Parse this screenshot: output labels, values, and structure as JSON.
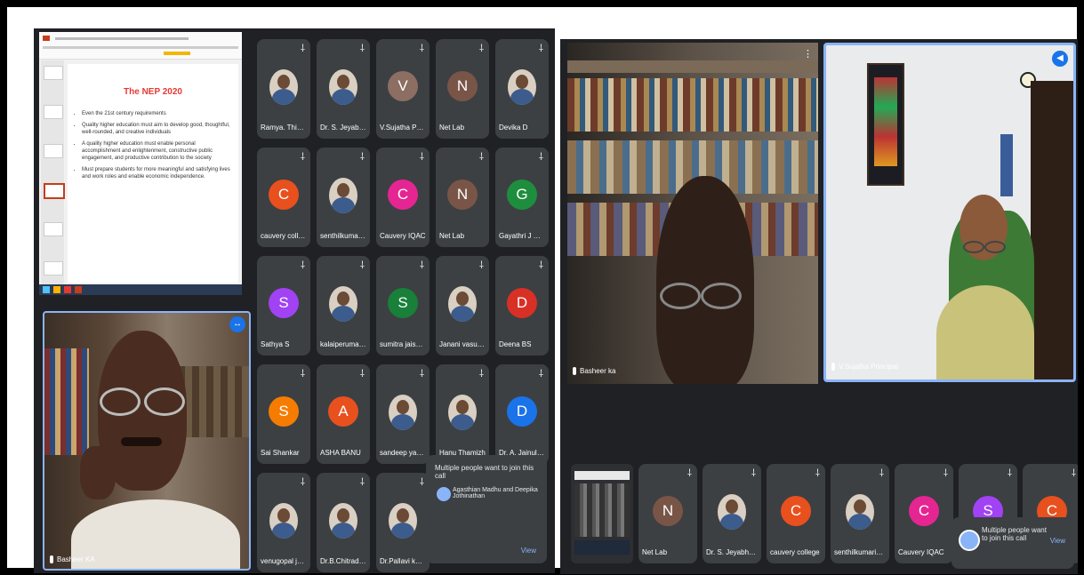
{
  "left_panel": {
    "slide": {
      "title": "The NEP 2020",
      "bullets": [
        "Even the 21st century requirements",
        "Quality higher education must aim to develop good, thoughtful, well-rounded, and creative individuals",
        "A quality higher education must enable personal accomplishment and enlightenment, constructive public engagement, and productive contribution to the society",
        "Must prepare students for more meaningful and satisfying lives and work roles and enable economic independence."
      ]
    },
    "speaker_name": "Basheer KA",
    "tiles": [
      {
        "name": "Ramya. Thiyagar...",
        "letter": "",
        "color": ""
      },
      {
        "name": "Dr. S. Jeyabharat...",
        "letter": "",
        "color": ""
      },
      {
        "name": "V.Sujatha Princip...",
        "letter": "V",
        "color": "#8d6e63"
      },
      {
        "name": "Net Lab",
        "letter": "N",
        "color": "#795548"
      },
      {
        "name": "Devika D",
        "letter": "",
        "color": ""
      },
      {
        "name": "cauvery college",
        "letter": "C",
        "color": "#e8501e"
      },
      {
        "name": "senthilkumaris E...",
        "letter": "",
        "color": ""
      },
      {
        "name": "Cauvery IQAC",
        "letter": "C",
        "color": "#e52592"
      },
      {
        "name": "Net Lab",
        "letter": "N",
        "color": "#795548"
      },
      {
        "name": "Gayathri J PSGR...",
        "letter": "G",
        "color": "#1e8e3e"
      },
      {
        "name": "Sathya S",
        "letter": "S",
        "color": "#a142f4"
      },
      {
        "name": "kalaiperumal se...",
        "letter": "",
        "color": ""
      },
      {
        "name": "sumitra jaiswal",
        "letter": "S",
        "color": "#188038"
      },
      {
        "name": "Janani vasudevan",
        "letter": "",
        "color": ""
      },
      {
        "name": "Deena BS",
        "letter": "D",
        "color": "#d93025"
      },
      {
        "name": "Sai Shankar",
        "letter": "S",
        "color": "#f57c00"
      },
      {
        "name": "ASHA BANU",
        "letter": "A",
        "color": "#e8501e"
      },
      {
        "name": "sandeep yadav",
        "letter": "",
        "color": ""
      },
      {
        "name": "Hanu Thamizh",
        "letter": "",
        "color": ""
      },
      {
        "name": "Dr. A. Jainulabd...",
        "letter": "D",
        "color": "#1a73e8"
      },
      {
        "name": "venugopal janar...",
        "letter": "",
        "color": ""
      },
      {
        "name": "Dr.B.Chitradevi",
        "letter": "",
        "color": ""
      },
      {
        "name": "Dr.Pallavi kunda...",
        "letter": "",
        "color": ""
      }
    ],
    "notice": {
      "title": "Multiple people want to join this call",
      "people": "Agasthian Madhu and Deepika Jothinathan",
      "view_label": "View"
    }
  },
  "right_panel": {
    "main_left_name": "Basheer ka",
    "main_right_name": "V.Sujatha Principal",
    "tiles": [
      {
        "name": "Net Lab",
        "letter": "N",
        "color": "#795548"
      },
      {
        "name": "Dr. S. Jeyabharathi...",
        "letter": "",
        "color": ""
      },
      {
        "name": "cauvery college",
        "letter": "C",
        "color": "#e8501e"
      },
      {
        "name": "senthilkumaris En...",
        "letter": "",
        "color": ""
      },
      {
        "name": "Cauvery IQAC",
        "letter": "C",
        "color": "#e52592"
      },
      {
        "name": "",
        "letter": "S",
        "color": "#a142f4"
      },
      {
        "name": "",
        "letter": "C",
        "color": "#e8501e"
      }
    ],
    "notice": {
      "title": "Multiple people want to join this call",
      "view_label": "View"
    }
  }
}
